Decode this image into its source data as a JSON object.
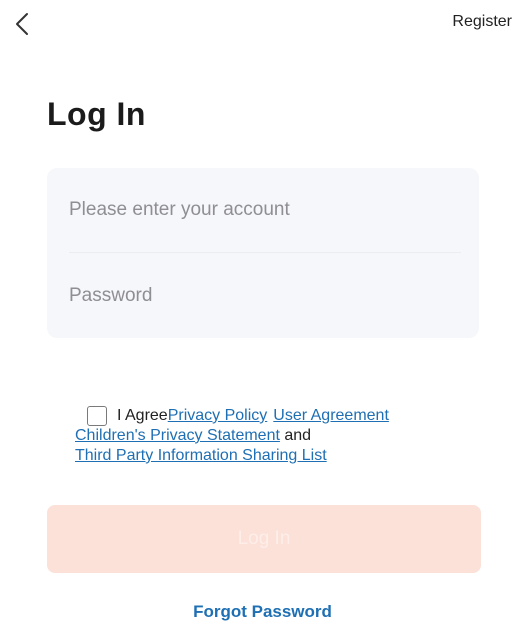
{
  "header": {
    "back_icon": "chevron-left-icon",
    "register_label": "Register"
  },
  "page": {
    "title": "Log In"
  },
  "form": {
    "account": {
      "value": "",
      "placeholder": "Please enter your account"
    },
    "password": {
      "value": "",
      "placeholder": "Password"
    }
  },
  "agreement": {
    "checked": false,
    "prefix": "I Agree",
    "privacy_policy": "Privacy Policy",
    "user_agreement": "User Agreement",
    "childrens_privacy": "Children's Privacy Statement",
    "and": "and",
    "third_party": "Third Party Information Sharing List"
  },
  "actions": {
    "login_label": "Log In",
    "forgot_password": "Forgot Password"
  },
  "colors": {
    "link": "#1e6fb3",
    "login_button_disabled": "#fbe1d8",
    "form_background": "#f6f7fa"
  }
}
